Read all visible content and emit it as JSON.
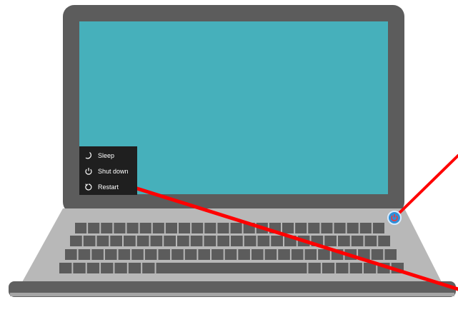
{
  "colors": {
    "screen": "#46b0bb",
    "bezel": "#5c5c5c",
    "base": "#b9b9b9",
    "keys": "#5c5c5c",
    "menu_bg": "#1f1f1f",
    "annotation_line": "#ff0000",
    "power_button": "#2f8fd8"
  },
  "power_menu": {
    "items": [
      {
        "label": "Sleep",
        "icon": "moon-icon"
      },
      {
        "label": "Shut down",
        "icon": "power-icon"
      },
      {
        "label": "Restart",
        "icon": "restart-icon"
      }
    ]
  },
  "power_button": {
    "icon": "power-icon"
  }
}
